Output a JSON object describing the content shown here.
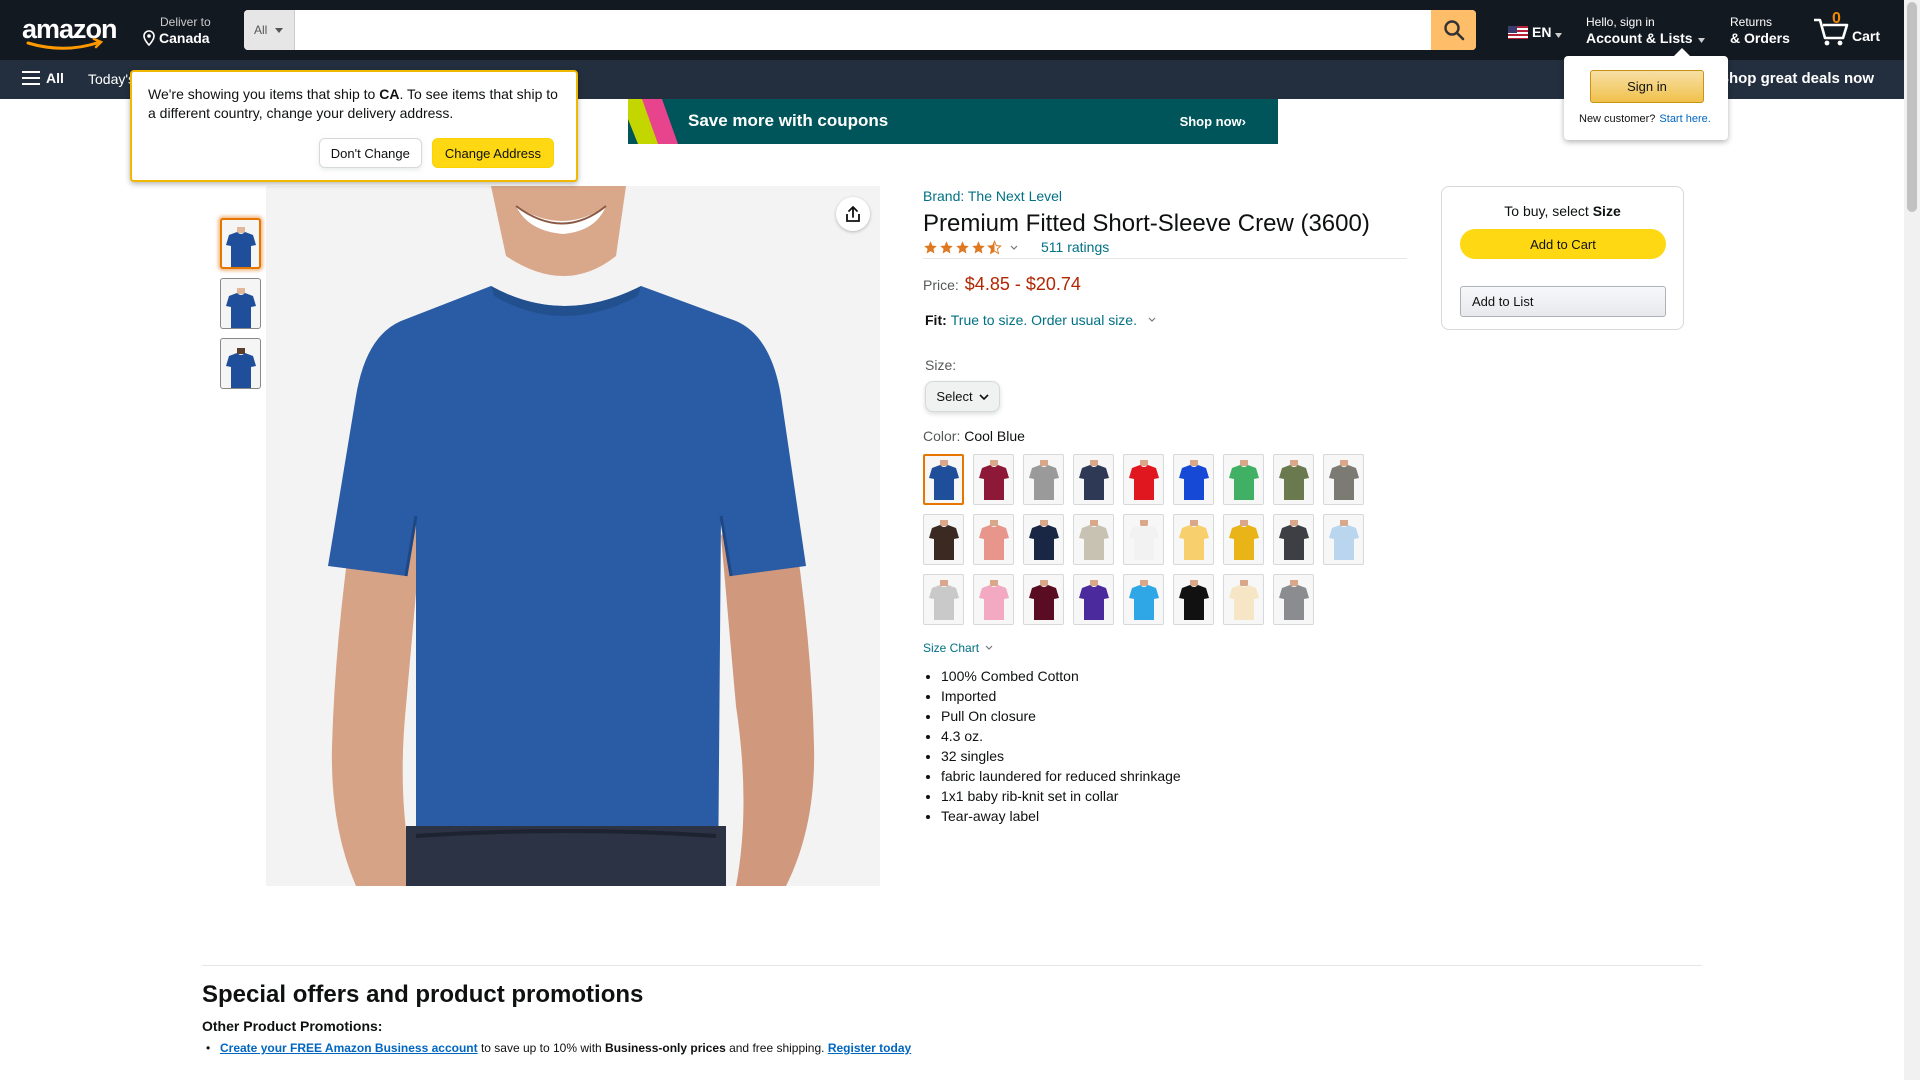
{
  "header": {
    "deliver_to_label": "Deliver to",
    "deliver_to_country": "Canada",
    "search_category": "All",
    "search_placeholder": "",
    "language": "EN",
    "account_greeting": "Hello, sign in",
    "account_label": "Account & Lists",
    "returns_label": "Returns",
    "orders_label": "& Orders",
    "cart_count": "0",
    "cart_label": "Cart"
  },
  "subnav": {
    "all_label": "All",
    "today_label": "Today's",
    "deals_label": "Shop great deals now"
  },
  "location_popover": {
    "text_before": "We're showing you items that ship to ",
    "country_code": "CA",
    "text_after": ". To see items that ship to a different country, change your delivery address.",
    "dont_change": "Don't Change",
    "change_address": "Change Address"
  },
  "signin_popover": {
    "sign_in": "Sign in",
    "new_customer": "New customer?",
    "start_here": "Start here."
  },
  "banner": {
    "title": "Save more with coupons",
    "cta": "Shop now›"
  },
  "product": {
    "brand": "Brand: The Next Level",
    "title": "Premium Fitted Short-Sleeve Crew (3600)",
    "rating": 4.5,
    "ratings_count": "511 ratings",
    "price_label": "Price:",
    "price": "$4.85 - $20.74",
    "fit_label": "Fit:",
    "fit_value": "True to size. Order usual size.",
    "size_label": "Size:",
    "size_select": "Select",
    "color_label": "Color: ",
    "color_value": "Cool Blue",
    "size_chart": "Size Chart",
    "features": [
      "100% Combed Cotton",
      "Imported",
      "Pull On closure",
      "4.3 oz.",
      "32 singles",
      "fabric laundered for reduced shrinkage",
      "1x1 baby rib-knit set in collar",
      "Tear-away label"
    ],
    "swatch_colors": [
      "#1f4f9a",
      "#8e1838",
      "#9a9a9a",
      "#2e3a55",
      "#e0171f",
      "#1549d6",
      "#3fb064",
      "#6b7a4e",
      "#7b7b74",
      "#3a2a22",
      "#e8958b",
      "#1a2744",
      "#c8c2b2",
      "#f2f2f2",
      "#f7cf6c",
      "#e8b417",
      "#3d3f44",
      "#b9d6ee",
      "#c9c9c9",
      "#f2a9c1",
      "#5a0d22",
      "#4a2a9c",
      "#2fa6e5",
      "#111111",
      "#f6e6c6",
      "#8a8c90"
    ]
  },
  "buybox": {
    "title_prefix": "To buy, select ",
    "title_bold": "Size",
    "add_to_cart": "Add to Cart",
    "add_to_list": "Add to List"
  },
  "offers": {
    "title": "Special offers and product promotions",
    "subtitle": "Other Product Promotions:",
    "link1": "Create your FREE Amazon Business account",
    "text1": " to save up to 10% with ",
    "bold1": "Business-only prices",
    "text2": " and free shipping. ",
    "link2": "Register today"
  },
  "colors": {
    "nav_dark": "#131921",
    "nav_light": "#232f3e",
    "search_button": "#febd69",
    "accent_orange": "#e77600",
    "price_red": "#b12704",
    "link_teal": "#007185",
    "add_to_cart_yellow": "#ffd814"
  }
}
